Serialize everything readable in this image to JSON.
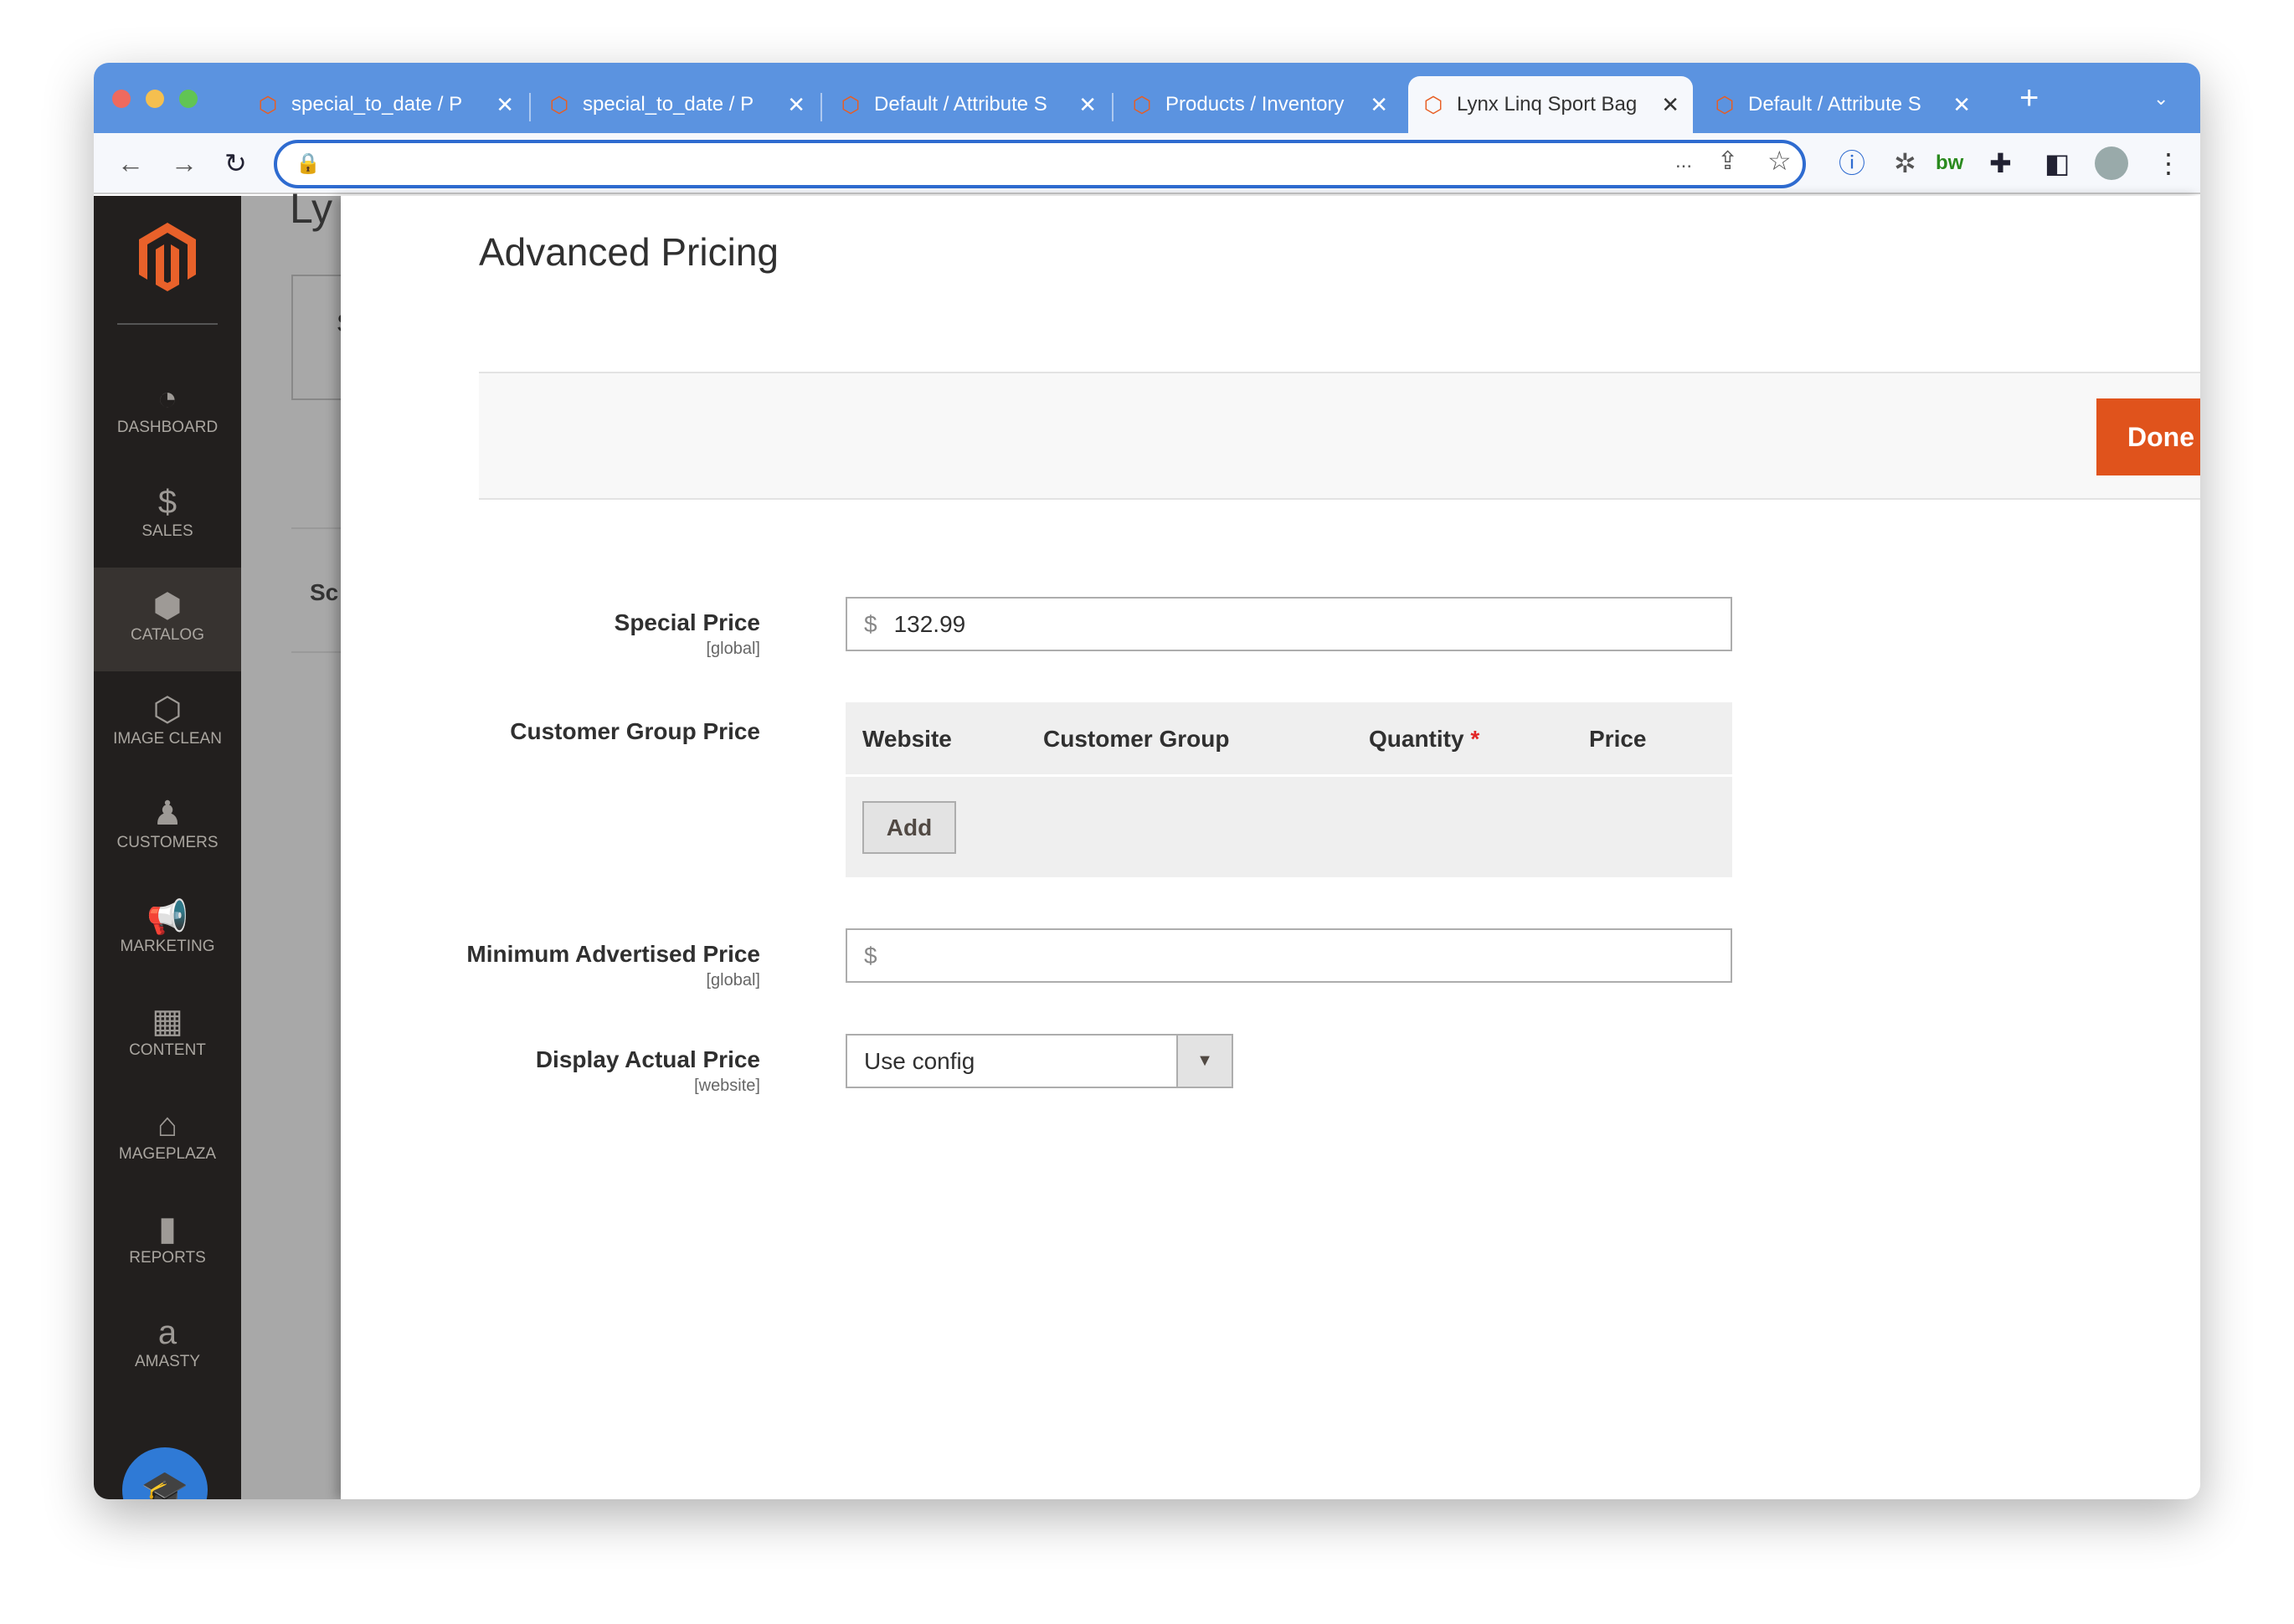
{
  "browser": {
    "tabs": [
      {
        "title": "special_to_date / P",
        "active": false
      },
      {
        "title": "special_to_date / P",
        "active": false
      },
      {
        "title": "Default / Attribute S",
        "active": false
      },
      {
        "title": "Products / Inventory",
        "active": false
      },
      {
        "title": "Lynx Linq Sport Bag",
        "active": true
      },
      {
        "title": "Default / Attribute S",
        "active": false
      }
    ],
    "new_tab": "+",
    "url_ellipsis": "..."
  },
  "sidebar": {
    "items": [
      {
        "label": "DASHBOARD",
        "icon": "gauge-icon",
        "glyph": "◔"
      },
      {
        "label": "SALES",
        "icon": "dollar-icon",
        "glyph": "$"
      },
      {
        "label": "CATALOG",
        "icon": "box-icon",
        "glyph": "⬢",
        "active": true
      },
      {
        "label": "IMAGE CLEAN",
        "icon": "hexagon-icon",
        "glyph": "⬡"
      },
      {
        "label": "CUSTOMERS",
        "icon": "person-icon",
        "glyph": "♟"
      },
      {
        "label": "MARKETING",
        "icon": "megaphone-icon",
        "glyph": "📢"
      },
      {
        "label": "CONTENT",
        "icon": "layout-icon",
        "glyph": "▦"
      },
      {
        "label": "MAGEPLAZA",
        "icon": "mageplaza-icon",
        "glyph": "⌂"
      },
      {
        "label": "REPORTS",
        "icon": "bar-chart-icon",
        "glyph": "▮"
      },
      {
        "label": "AMASTY",
        "icon": "amasty-icon",
        "glyph": "a"
      }
    ]
  },
  "background": {
    "title_fragment": "Ly",
    "s_fragment": "S",
    "sc_fragment": "Sc"
  },
  "modal": {
    "title": "Advanced Pricing",
    "done_label": "Done",
    "special_price": {
      "label": "Special Price",
      "scope": "[global]",
      "currency": "$",
      "value": "132.99"
    },
    "customer_group_price": {
      "label": "Customer Group Price",
      "columns": [
        "Website",
        "Customer Group",
        "Quantity",
        "Price"
      ],
      "required_mark": "*",
      "add_label": "Add"
    },
    "map": {
      "label": "Minimum Advertised Price",
      "scope": "[global]",
      "currency": "$",
      "value": ""
    },
    "display_actual_price": {
      "label": "Display Actual Price",
      "scope": "[website]",
      "value": "Use config"
    }
  },
  "colors": {
    "accent": "#e0531c",
    "tabbar": "#5b93e0",
    "sidebar": "#221f1e"
  }
}
